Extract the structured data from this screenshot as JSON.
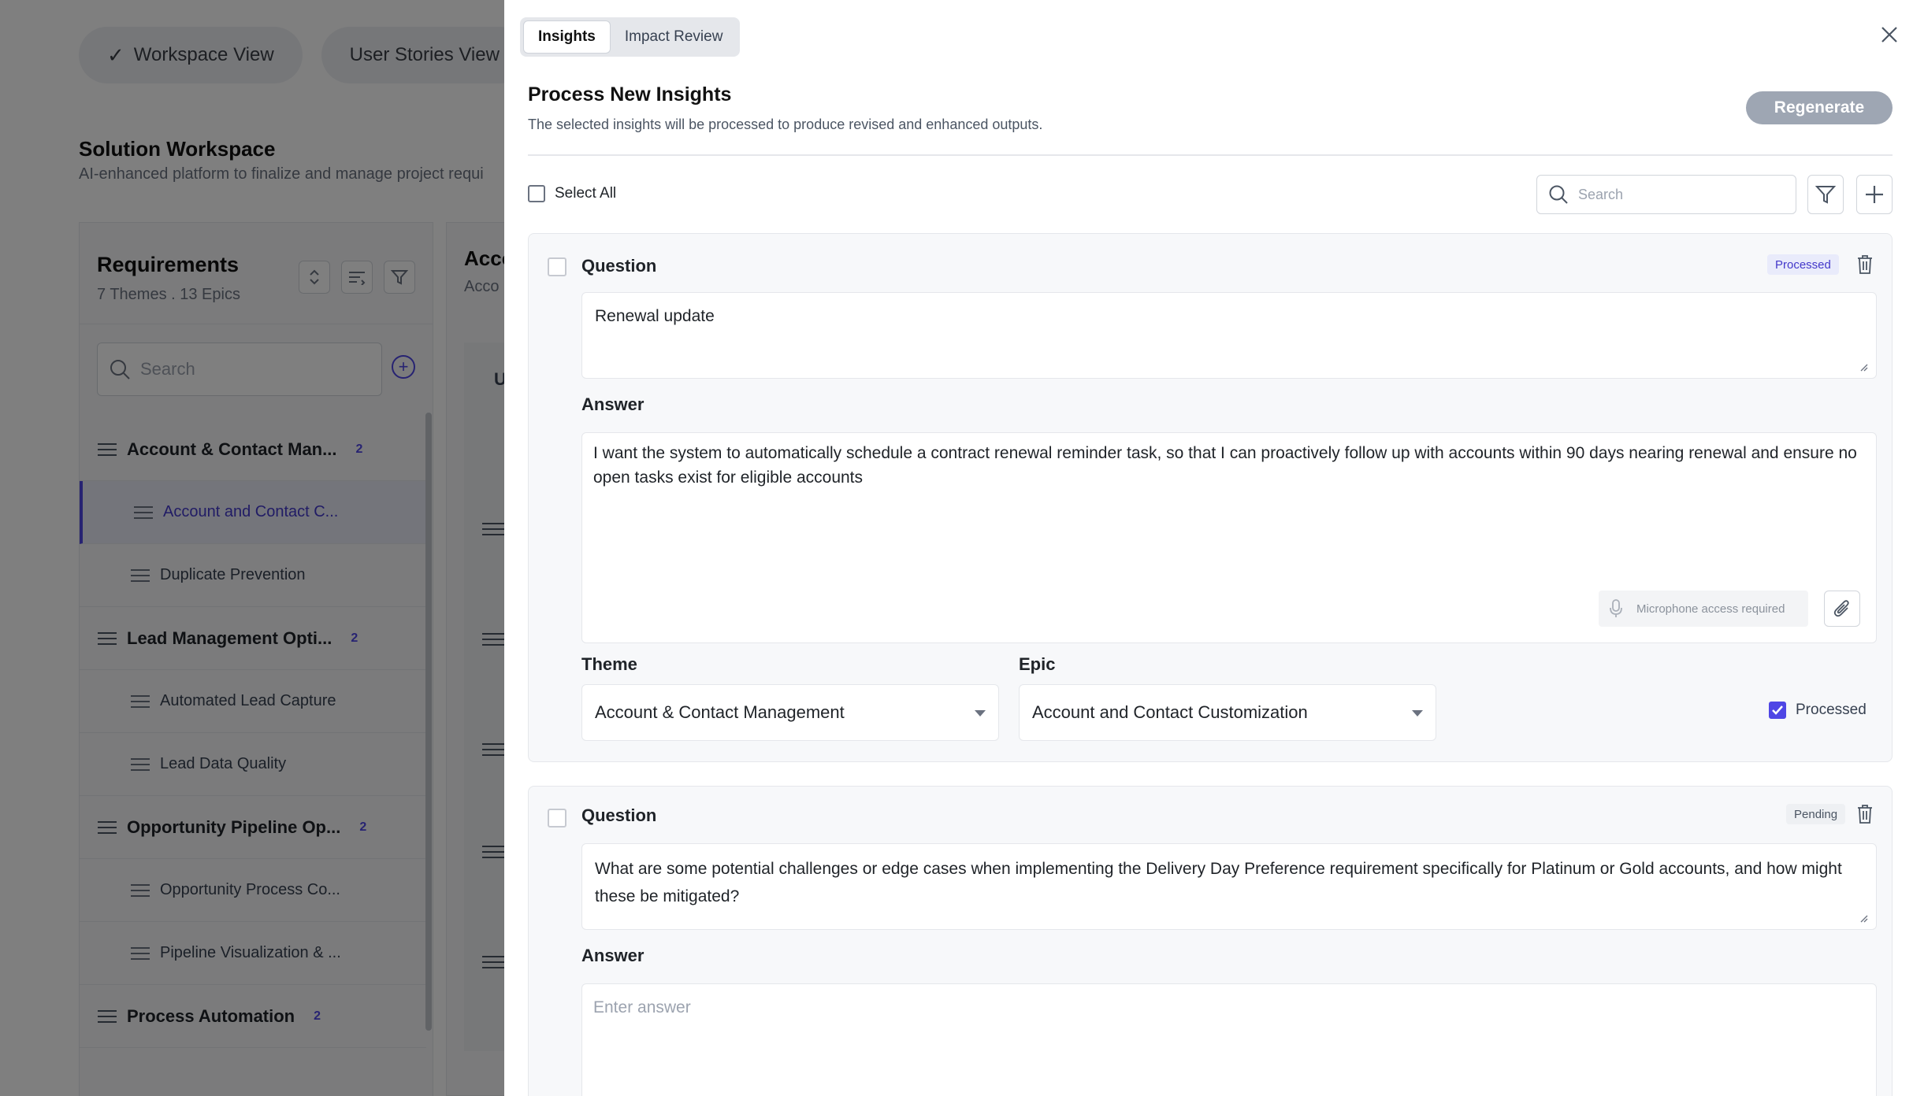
{
  "background": {
    "view_tabs": [
      {
        "label": "Workspace View",
        "checked": true
      },
      {
        "label": "User Stories View"
      }
    ],
    "workspace_title": "Solution Workspace",
    "workspace_subtitle": "AI-enhanced platform to finalize and manage project requi",
    "requirements": {
      "title": "Requirements",
      "subtitle": "7 Themes . 13 Epics",
      "search_placeholder": "Search",
      "tree": [
        {
          "label": "Account & Contact Man...",
          "count": "2",
          "children": [
            {
              "label": "Account and Contact C...",
              "active": true
            },
            {
              "label": "Duplicate Prevention"
            }
          ]
        },
        {
          "label": "Lead Management Opti...",
          "count": "2",
          "children": [
            {
              "label": "Automated Lead Capture"
            },
            {
              "label": "Lead Data Quality"
            }
          ]
        },
        {
          "label": "Opportunity Pipeline Op...",
          "count": "2",
          "children": [
            {
              "label": "Opportunity Process Co..."
            },
            {
              "label": "Pipeline Visualization & ..."
            }
          ]
        },
        {
          "label": "Process Automation",
          "count": "2",
          "children": []
        }
      ]
    },
    "accounts_panel": {
      "title": "Acco",
      "subtitle": "Acco",
      "column_letter": "U"
    }
  },
  "drawer": {
    "tabs": [
      {
        "label": "Insights",
        "active": true
      },
      {
        "label": "Impact Review",
        "active": false
      }
    ],
    "title": "Process New Insights",
    "subtitle": "The selected insights will be processed to produce revised and enhanced outputs.",
    "regenerate_label": "Regenerate",
    "select_all_label": "Select All",
    "search_placeholder": "Search",
    "accent_color": "#4f46e5",
    "cards": [
      {
        "question_label": "Question",
        "status": "Processed",
        "question": "Renewal update",
        "answer_label": "Answer",
        "answer": "I want the system to automatically schedule a contract renewal reminder task, so that I can proactively follow up with accounts within 90 days nearing renewal and ensure no open tasks exist for eligible accounts",
        "mic_text": "Microphone access required",
        "theme_label": "Theme",
        "theme_value": "Account & Contact Management",
        "epic_label": "Epic",
        "epic_value": "Account and Contact Customization",
        "processed_checkbox_label": "Processed",
        "processed_checked": true
      },
      {
        "question_label": "Question",
        "status": "Pending",
        "question": "What are some potential challenges or edge cases when implementing the Delivery Day Preference requirement specifically for Platinum or Gold accounts, and how might these be mitigated?",
        "answer_label": "Answer",
        "answer_placeholder": "Enter answer"
      }
    ]
  }
}
